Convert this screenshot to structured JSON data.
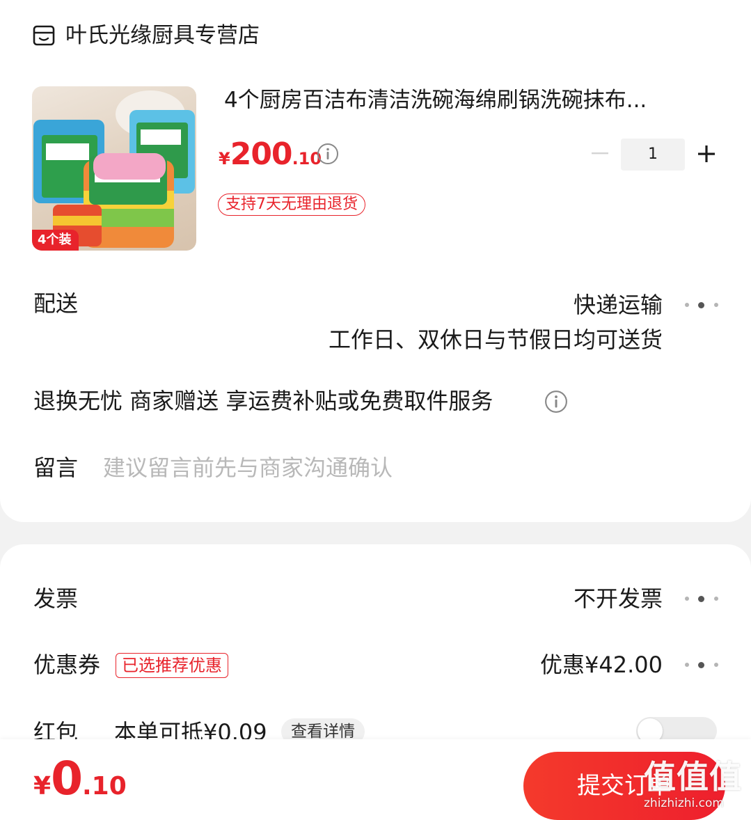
{
  "store": {
    "name": "叶氏光缘厨具专营店",
    "icon": "store-icon"
  },
  "product": {
    "title": "4个厨房百洁布清洁洗碗海绵刷锅洗碗抹布...",
    "image_badge": "4个装",
    "price_currency": "¥",
    "price_integer": "200",
    "price_decimal": ".10",
    "quantity": "1",
    "return_policy": "支持7天无理由退货"
  },
  "delivery": {
    "label": "配送",
    "method": "快递运输",
    "note": "工作日、双休日与节假日均可送货"
  },
  "service": {
    "text": "退换无忧 商家赠送 享运费补贴或免费取件服务"
  },
  "message": {
    "label": "留言",
    "placeholder": "建议留言前先与商家沟通确认"
  },
  "invoice": {
    "label": "发票",
    "value": "不开发票"
  },
  "coupon": {
    "label": "优惠券",
    "tag": "已选推荐优惠",
    "value": "优惠¥42.00"
  },
  "red_packet": {
    "label": "红包",
    "deduct": "本单可抵¥0.09",
    "detail_button": "查看详情",
    "enabled": false
  },
  "footer": {
    "total_currency": "¥",
    "total_integer": "0",
    "total_decimal": ".10",
    "submit_label": "提交订单"
  },
  "watermark": {
    "text": "值值值",
    "url": "zhizhizhi.com"
  },
  "colors": {
    "accent": "#e8232b",
    "background": "#f2f2f2",
    "card": "#ffffff"
  }
}
